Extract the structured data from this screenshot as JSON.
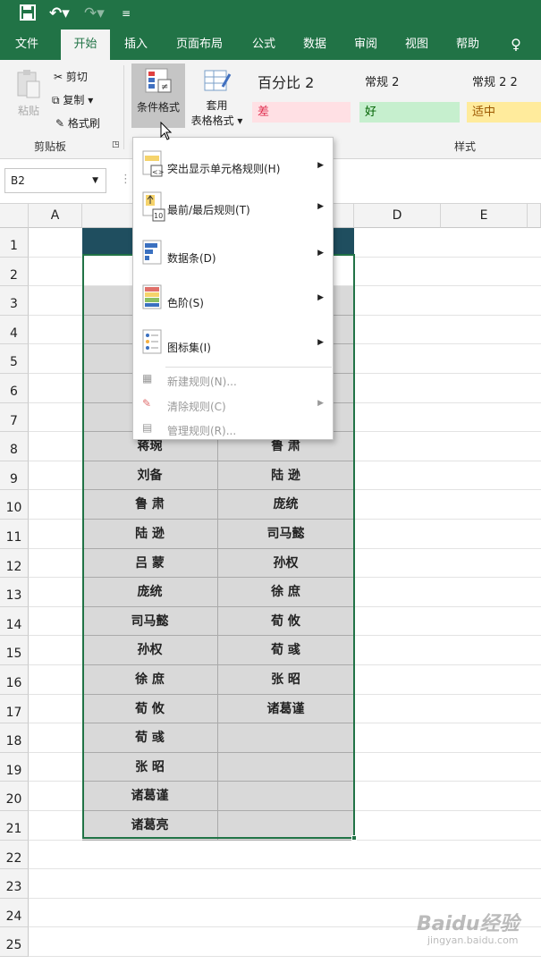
{
  "qat": {
    "save_icon": "save-icon",
    "undo_icon": "undo-icon",
    "redo_icon": "redo-icon",
    "customize_icon": "customize-icon"
  },
  "tabs": [
    {
      "label": "文件"
    },
    {
      "label": "开始"
    },
    {
      "label": "插入"
    },
    {
      "label": "页面布局"
    },
    {
      "label": "公式"
    },
    {
      "label": "数据"
    },
    {
      "label": "审阅"
    },
    {
      "label": "视图"
    },
    {
      "label": "帮助"
    },
    {
      "label": "♀"
    }
  ],
  "ribbon": {
    "paste": "粘贴",
    "cut": "剪切",
    "copy": "复制",
    "format_painter": "格式刷",
    "clipboard_group": "剪贴板",
    "conditional_format": "条件格式",
    "format_as_table_1": "套用",
    "format_as_table_2": "表格格式",
    "style_percent": "百分比 2",
    "style_normal2": "常规 2",
    "style_normal22": "常规 2 2",
    "style_bad": "差",
    "style_good": "好",
    "style_neutral": "适中",
    "styles_group": "样式"
  },
  "formula": {
    "namebox": "B2"
  },
  "columns": [
    "A",
    "D",
    "E"
  ],
  "rows": [
    "1",
    "2",
    "3",
    "4",
    "5",
    "6",
    "7",
    "8",
    "9",
    "10",
    "11",
    "12",
    "13",
    "14",
    "15",
    "16",
    "17",
    "18",
    "19",
    "20",
    "21",
    "22",
    "23",
    "24",
    "25"
  ],
  "table": {
    "colB": [
      "蒋琬",
      "刘备",
      "鲁 肃",
      "陆 逊",
      "吕 蒙",
      "庞统",
      "司马懿",
      "孙权",
      "徐 庶",
      "荀 攸",
      "荀 彧",
      "张 昭",
      "诸葛谨",
      "诸葛亮"
    ],
    "colC": [
      "鲁 肃",
      "陆 逊",
      "庞统",
      "司马懿",
      "孙权",
      "徐 庶",
      "荀 攸",
      "荀 彧",
      "张 昭",
      "诸葛谨",
      "",
      "",
      "",
      ""
    ]
  },
  "menu": {
    "highlight": "突出显示单元格规则(H)",
    "topbottom": "最前/最后规则(T)",
    "databar": "数据条(D)",
    "colorscale": "色阶(S)",
    "iconset": "图标集(I)",
    "newrule": "新建规则(N)...",
    "clearrule": "清除规则(C)",
    "managerule": "管理规则(R)..."
  },
  "watermark": {
    "brand": "Baidu经验",
    "url": "jingyan.baidu.com"
  },
  "colors": {
    "excel_green": "#217346",
    "bad_bg": "#ffc7ce",
    "bad_fg": "#9c0006",
    "good_bg": "#c6efce",
    "neutral_bg": "#ffeb9c",
    "header_dark": "#1f4e5f"
  }
}
